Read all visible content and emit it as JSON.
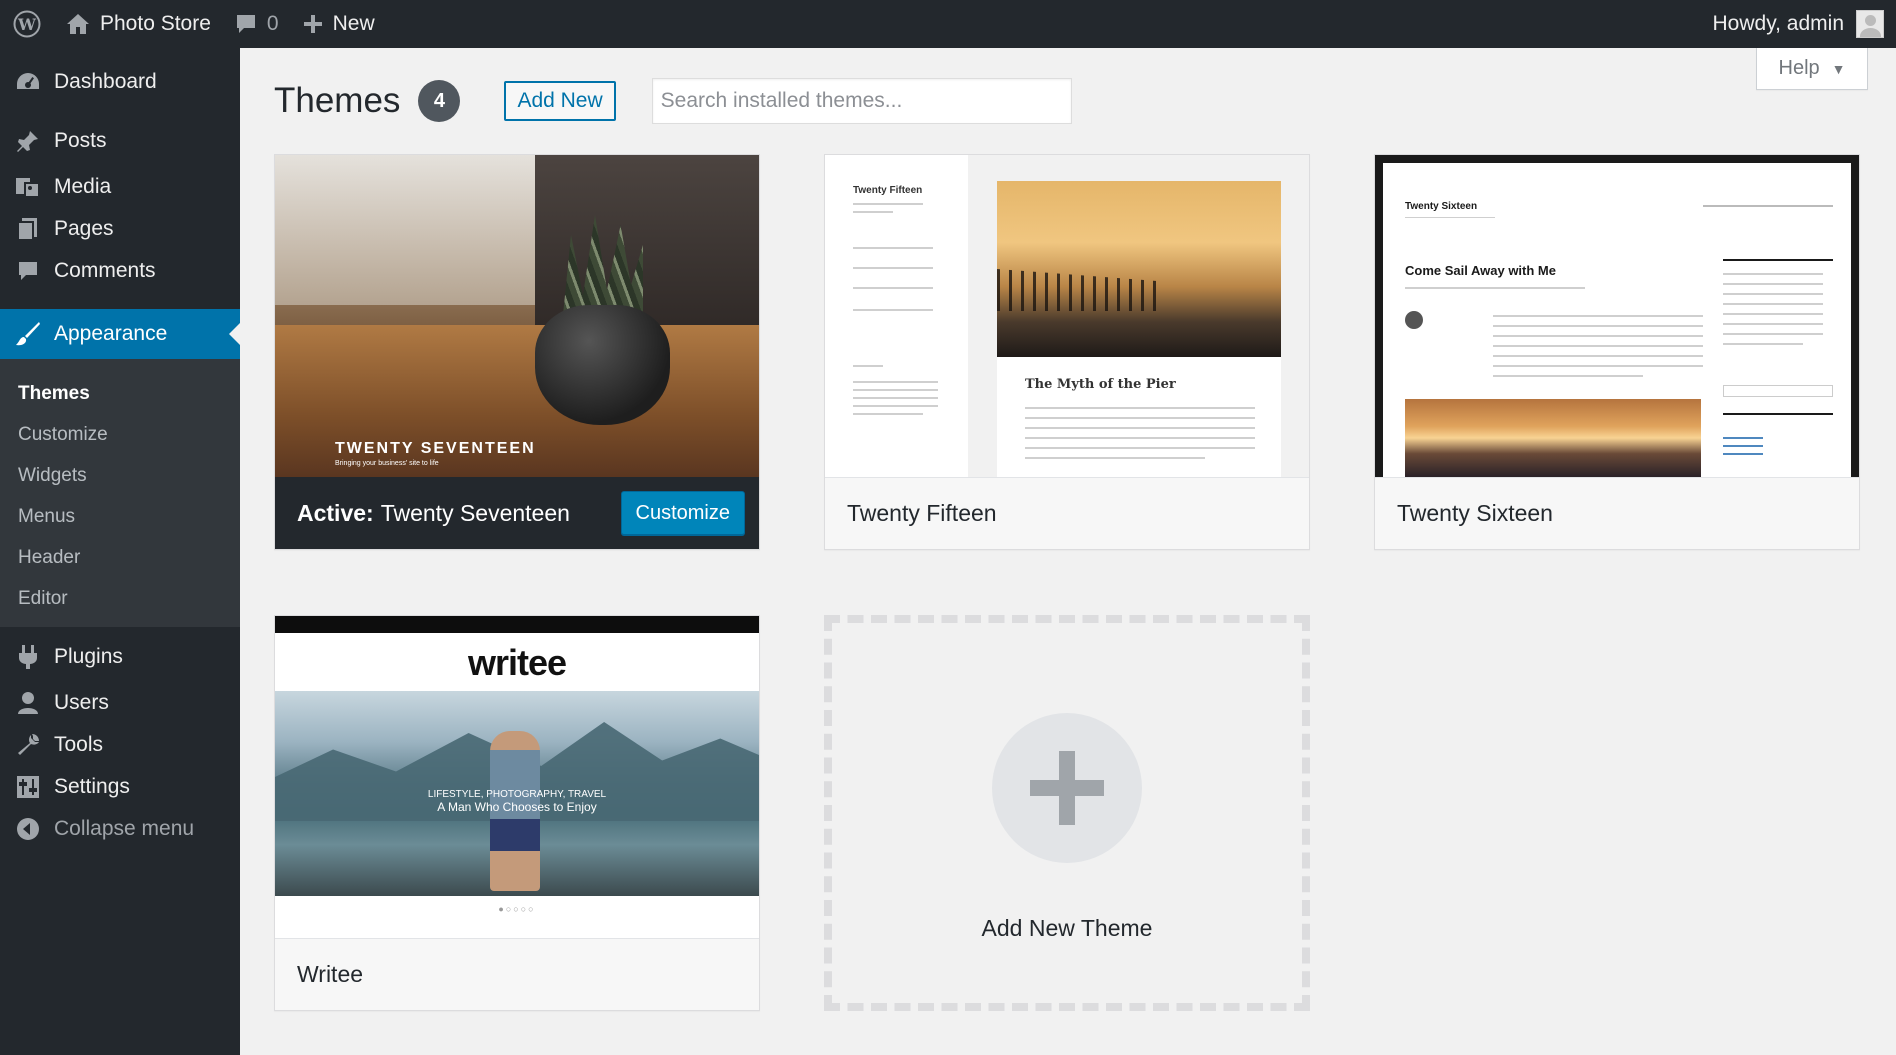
{
  "adminbar": {
    "site_name": "Photo Store",
    "comments_count": "0",
    "new_label": "New",
    "greeting": "Howdy, admin"
  },
  "sidebar": {
    "items": [
      {
        "label": "Dashboard",
        "icon": "dashboard-icon"
      },
      {
        "label": "Posts",
        "icon": "pin-icon"
      },
      {
        "label": "Media",
        "icon": "media-icon"
      },
      {
        "label": "Pages",
        "icon": "pages-icon"
      },
      {
        "label": "Comments",
        "icon": "comment-icon"
      },
      {
        "label": "Appearance",
        "icon": "brush-icon"
      },
      {
        "label": "Plugins",
        "icon": "plugin-icon"
      },
      {
        "label": "Users",
        "icon": "user-icon"
      },
      {
        "label": "Tools",
        "icon": "wrench-icon"
      },
      {
        "label": "Settings",
        "icon": "settings-icon"
      }
    ],
    "submenu": [
      "Themes",
      "Customize",
      "Widgets",
      "Menus",
      "Header",
      "Editor"
    ],
    "collapse_label": "Collapse menu"
  },
  "main": {
    "help_label": "Help",
    "title": "Themes",
    "count": "4",
    "add_new_label": "Add New",
    "search_placeholder": "Search installed themes...",
    "themes": [
      {
        "name": "Twenty Seventeen",
        "active_prefix": "Active:",
        "action": "Customize",
        "screenshot_title": "TWENTY SEVENTEEN",
        "screenshot_tagline": "Bringing your business' site to life"
      },
      {
        "name": "Twenty Fifteen",
        "screenshot_site": "Twenty Fifteen",
        "screenshot_post": "The Myth of the Pier"
      },
      {
        "name": "Twenty Sixteen",
        "screenshot_site": "Twenty Sixteen",
        "screenshot_post": "Come Sail Away with Me"
      },
      {
        "name": "Writee",
        "screenshot_logo": "writee",
        "screenshot_tagline": "LIFESTYLE, PHOTOGRAPHY, TRAVEL",
        "screenshot_headline": "A Man Who Chooses to Enjoy"
      }
    ],
    "add_new_theme_label": "Add New Theme"
  },
  "colors": {
    "admin_dark": "#23282d",
    "accent": "#0073aa",
    "button_blue": "#0085ba",
    "background": "#f1f1f1"
  }
}
